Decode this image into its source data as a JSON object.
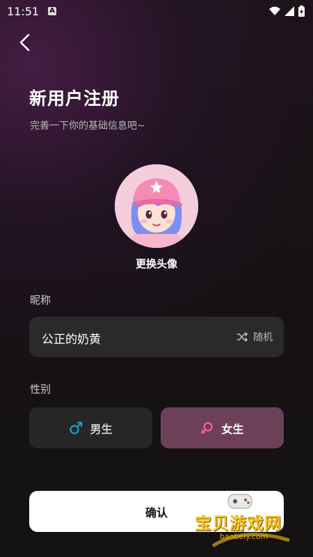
{
  "status_bar": {
    "time": "11:51",
    "notification_icon": "A"
  },
  "header": {
    "title": "新用户注册",
    "subtitle": "完善一下你的基础信息吧~"
  },
  "avatar": {
    "change_label": "更换头像"
  },
  "nickname": {
    "label": "昵称",
    "value": "公正的奶黄",
    "random_label": "随机"
  },
  "gender": {
    "label": "性别",
    "male_label": "男生",
    "female_label": "女生",
    "selected": "female",
    "male_color": "#1aa3c8",
    "female_color": "#ff5fa8"
  },
  "confirm": {
    "label": "确认"
  },
  "watermark": {
    "text": "宝贝游戏网",
    "url": "baobeiy.com"
  },
  "colors": {
    "female_selected_bg": "#6d4058",
    "field_bg": "#2a2a2c"
  }
}
